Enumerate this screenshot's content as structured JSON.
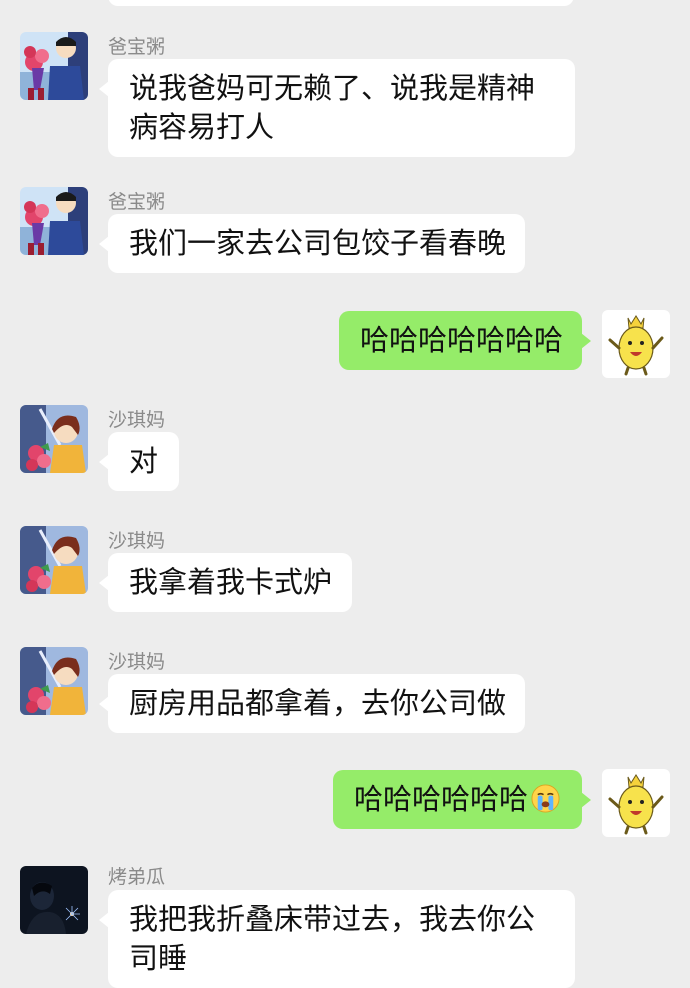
{
  "messages": [
    {
      "side": "left",
      "sender": "爸宝粥",
      "text": "说我爸妈可无赖了、说我是精神病容易打人",
      "avatar_icon": "shinchan-dad-bouquet-avatar"
    },
    {
      "side": "left",
      "sender": "爸宝粥",
      "text": "我们一家去公司包饺子看春晚",
      "avatar_icon": "shinchan-dad-bouquet-avatar"
    },
    {
      "side": "right",
      "text": "哈哈哈哈哈哈哈",
      "avatar_icon": "yellow-crown-mascot-avatar"
    },
    {
      "side": "left",
      "sender": "沙琪妈",
      "text": "对",
      "avatar_icon": "shinchan-mom-bouquet-avatar"
    },
    {
      "side": "left",
      "sender": "沙琪妈",
      "text": "我拿着我卡式炉",
      "avatar_icon": "shinchan-mom-bouquet-avatar"
    },
    {
      "side": "left",
      "sender": "沙琪妈",
      "text": "厨房用品都拿着，去你公司做",
      "avatar_icon": "shinchan-mom-bouquet-avatar"
    },
    {
      "side": "right",
      "text": "哈哈哈哈哈哈",
      "emoji": "crying-face-emoji",
      "avatar_icon": "yellow-crown-mascot-avatar"
    },
    {
      "side": "left",
      "sender": "烤弟瓜",
      "text": "我把我折叠床带过去，我去你公司睡",
      "avatar_icon": "dark-sparkler-photo-avatar"
    }
  ],
  "colors": {
    "background": "#ededed",
    "incoming_bubble": "#ffffff",
    "outgoing_bubble": "#95ec69",
    "sender_name": "#8a8a8a",
    "text": "#111111"
  }
}
